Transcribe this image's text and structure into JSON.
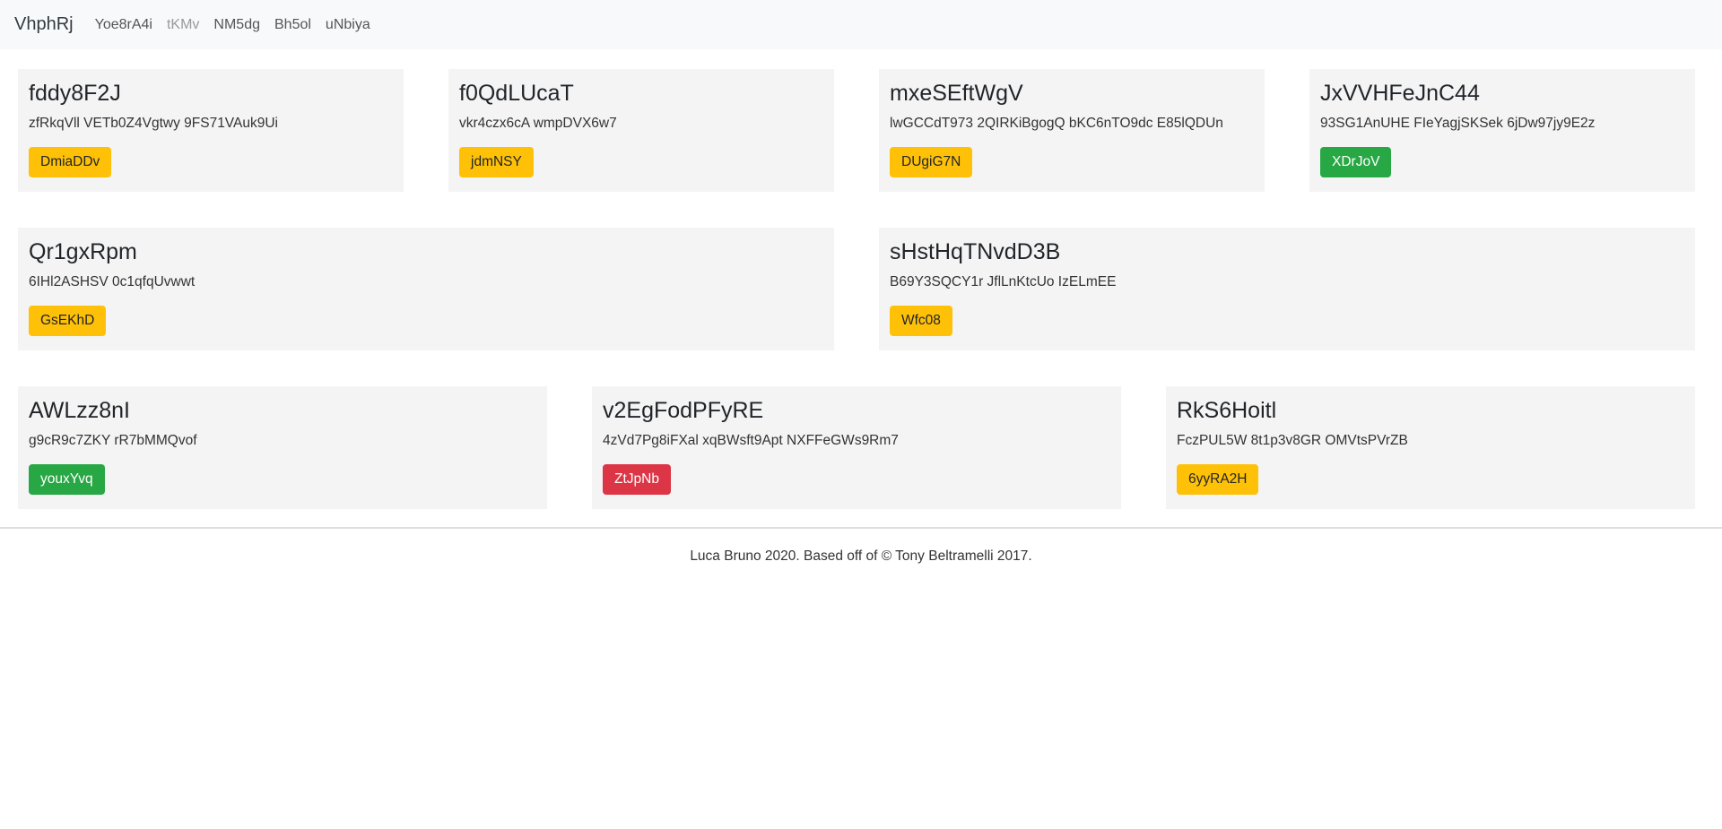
{
  "navbar": {
    "brand": "VhphRj",
    "links": [
      {
        "label": "Yoe8rA4i",
        "muted": false
      },
      {
        "label": "tKMv",
        "muted": true
      },
      {
        "label": "NM5dg",
        "muted": false
      },
      {
        "label": "Bh5ol",
        "muted": false
      },
      {
        "label": "uNbiya",
        "muted": false
      }
    ]
  },
  "rows": [
    {
      "cards": [
        {
          "title": "fddy8F2J",
          "text": "zfRkqVll VETb0Z4Vgtwy 9FS71VAuk9Ui",
          "button": "DmiaDDv",
          "button_variant": "warning"
        },
        {
          "title": "f0QdLUcaT",
          "text": "vkr4czx6cA wmpDVX6w7",
          "button": "jdmNSY",
          "button_variant": "warning"
        },
        {
          "title": "mxeSEftWgV",
          "text": "lwGCCdT973 2QIRKiBgogQ bKC6nTO9dc E85lQDUn",
          "button": "DUgiG7N",
          "button_variant": "warning"
        },
        {
          "title": "JxVVHFeJnC44",
          "text": "93SG1AnUHE FIeYagjSKSek 6jDw97jy9E2z",
          "button": "XDrJoV",
          "button_variant": "success"
        }
      ]
    },
    {
      "cards": [
        {
          "title": "Qr1gxRpm",
          "text": "6IHl2ASHSV 0c1qfqUvwwt",
          "button": "GsEKhD",
          "button_variant": "warning"
        },
        {
          "title": "sHstHqTNvdD3B",
          "text": "B69Y3SQCY1r JflLnKtcUo IzELmEE",
          "button": "Wfc08",
          "button_variant": "warning"
        }
      ]
    },
    {
      "cards": [
        {
          "title": "AWLzz8nI",
          "text": "g9cR9c7ZKY rR7bMMQvof",
          "button": "youxYvq",
          "button_variant": "success"
        },
        {
          "title": "v2EgFodPFyRE",
          "text": "4zVd7Pg8iFXal xqBWsft9Apt NXFFeGWs9Rm7",
          "button": "ZtJpNb",
          "button_variant": "danger"
        },
        {
          "title": "RkS6Hoitl",
          "text": "FczPUL5W 8t1p3v8GR OMVtsPVrZB",
          "button": "6yyRA2H",
          "button_variant": "warning"
        }
      ]
    }
  ],
  "footer": {
    "text": "Luca Bruno 2020. Based off of © Tony Beltramelli 2017."
  },
  "colors": {
    "warning": "#ffc107",
    "success": "#28a745",
    "danger": "#dc3545",
    "navbar_bg": "#f8f9fa",
    "card_bg": "#f4f4f4"
  }
}
